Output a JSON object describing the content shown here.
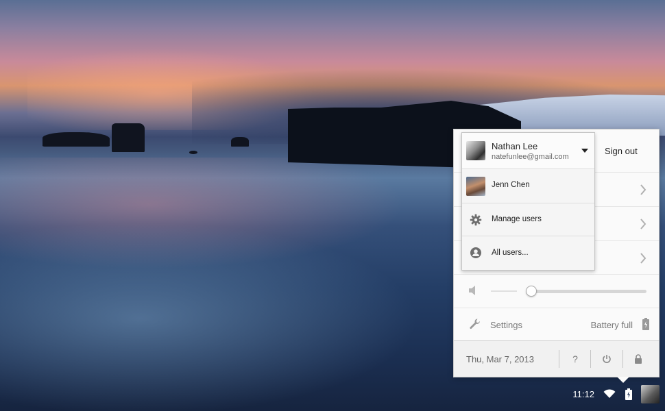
{
  "shelf": {
    "time": "11:12",
    "icons": [
      "wifi-icon",
      "battery-charging-icon",
      "user-avatar"
    ]
  },
  "tray": {
    "sign_out_label": "Sign out",
    "volume": {
      "level_percent": 0,
      "icon": "speaker-icon"
    },
    "settings_label": "Settings",
    "battery_label": "Battery full",
    "date_label": "Thu, Mar 7, 2013",
    "bottom_buttons": [
      "help-icon",
      "power-icon",
      "lock-icon"
    ]
  },
  "user_menu": {
    "current_user": {
      "name": "Nathan Lee",
      "email": "natefunlee@gmail.com"
    },
    "other_user": {
      "name": "Jenn Chen"
    },
    "manage_users_label": "Manage users",
    "all_users_label": "All users..."
  },
  "colors": {
    "panel_bg": "#fafafa",
    "card_bg": "#f5f5f5",
    "text_primary": "#222222",
    "text_secondary": "#777777"
  }
}
